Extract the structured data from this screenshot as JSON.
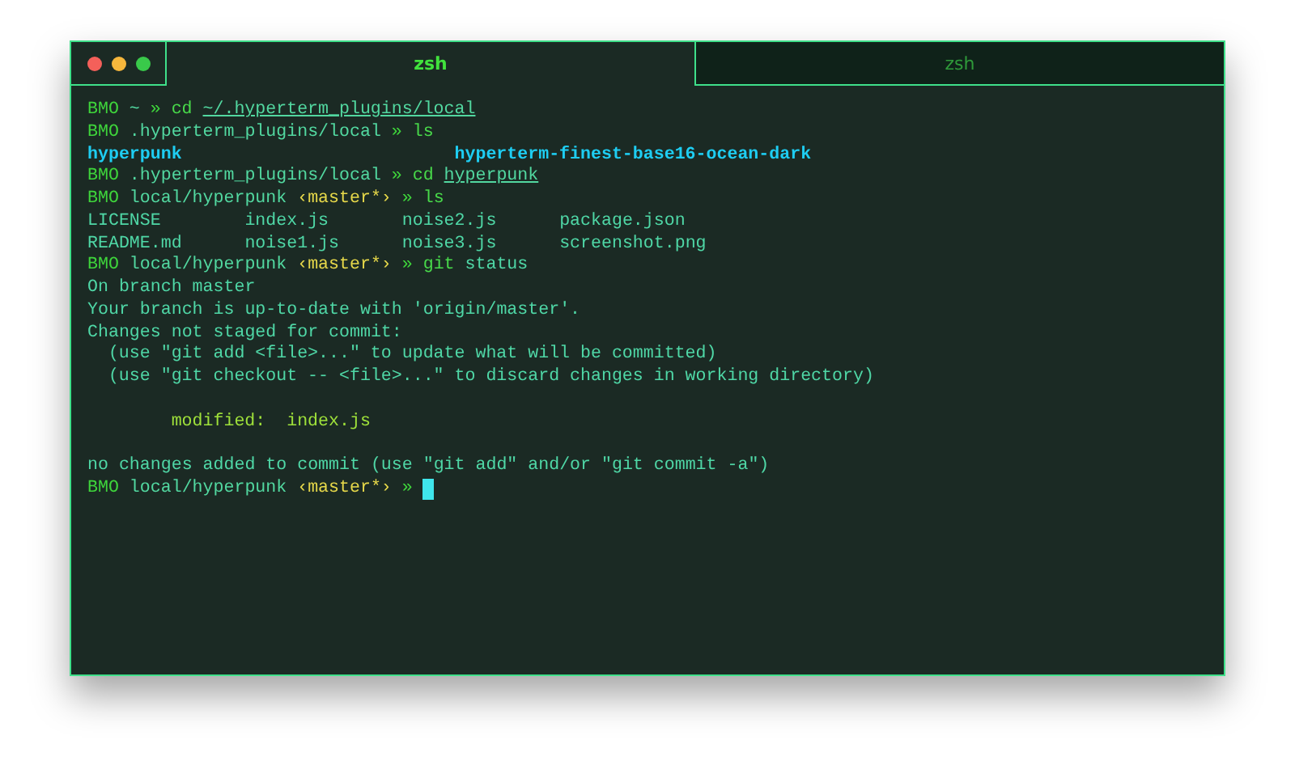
{
  "tabs": [
    {
      "label": "zsh",
      "selected": true
    },
    {
      "label": "zsh",
      "selected": false
    }
  ],
  "lines": [
    {
      "kind": "prompt",
      "segments": [
        {
          "kind": "host",
          "text": "BMO"
        },
        {
          "kind": "path",
          "text": "~"
        },
        {
          "kind": "sep",
          "text": "»"
        },
        {
          "kind": "cmd",
          "text": "cd"
        },
        {
          "kind": "link",
          "text": "~/.hyperterm_plugins/local"
        }
      ]
    },
    {
      "kind": "prompt",
      "segments": [
        {
          "kind": "host",
          "text": "BMO"
        },
        {
          "kind": "path",
          "text": ".hyperterm_plugins/local"
        },
        {
          "kind": "sep",
          "text": "»"
        },
        {
          "kind": "cmd",
          "text": "ls"
        }
      ]
    },
    {
      "kind": "dirs",
      "items": [
        "hyperpunk",
        "hyperterm-finest-base16-ocean-dark"
      ]
    },
    {
      "kind": "prompt",
      "segments": [
        {
          "kind": "host",
          "text": "BMO"
        },
        {
          "kind": "path",
          "text": ".hyperterm_plugins/local"
        },
        {
          "kind": "sep",
          "text": "»"
        },
        {
          "kind": "cmd",
          "text": "cd"
        },
        {
          "kind": "link",
          "text": "hyperpunk"
        }
      ]
    },
    {
      "kind": "prompt",
      "segments": [
        {
          "kind": "host",
          "text": "BMO"
        },
        {
          "kind": "path",
          "text": "local/hyperpunk"
        },
        {
          "kind": "branch",
          "text": "‹master*›"
        },
        {
          "kind": "sep",
          "text": "»"
        },
        {
          "kind": "cmd",
          "text": "ls"
        }
      ]
    },
    {
      "kind": "files",
      "items": [
        "LICENSE",
        "index.js",
        "noise2.js",
        "package.json"
      ]
    },
    {
      "kind": "files",
      "items": [
        "README.md",
        "noise1.js",
        "noise3.js",
        "screenshot.png"
      ]
    },
    {
      "kind": "prompt",
      "segments": [
        {
          "kind": "host",
          "text": "BMO"
        },
        {
          "kind": "path",
          "text": "local/hyperpunk"
        },
        {
          "kind": "branch",
          "text": "‹master*›"
        },
        {
          "kind": "sep",
          "text": "»"
        },
        {
          "kind": "cmd",
          "text": "git"
        },
        {
          "kind": "arg",
          "text": "status"
        }
      ]
    },
    {
      "kind": "output",
      "text": "On branch master"
    },
    {
      "kind": "output",
      "text": "Your branch is up-to-date with 'origin/master'."
    },
    {
      "kind": "output",
      "text": "Changes not staged for commit:"
    },
    {
      "kind": "hint",
      "text": "(use \"git add <file>...\" to update what will be committed)"
    },
    {
      "kind": "hint",
      "text": "(use \"git checkout -- <file>...\" to discard changes in working directory)"
    },
    {
      "kind": "blank"
    },
    {
      "kind": "modified",
      "label": "modified:",
      "file": "index.js"
    },
    {
      "kind": "blank"
    },
    {
      "kind": "output",
      "text": "no changes added to commit (use \"git add\" and/or \"git commit -a\")"
    },
    {
      "kind": "prompt",
      "cursor": true,
      "segments": [
        {
          "kind": "host",
          "text": "BMO"
        },
        {
          "kind": "path",
          "text": "local/hyperpunk"
        },
        {
          "kind": "branch",
          "text": "‹master*›"
        },
        {
          "kind": "sep",
          "text": "»"
        }
      ]
    }
  ]
}
